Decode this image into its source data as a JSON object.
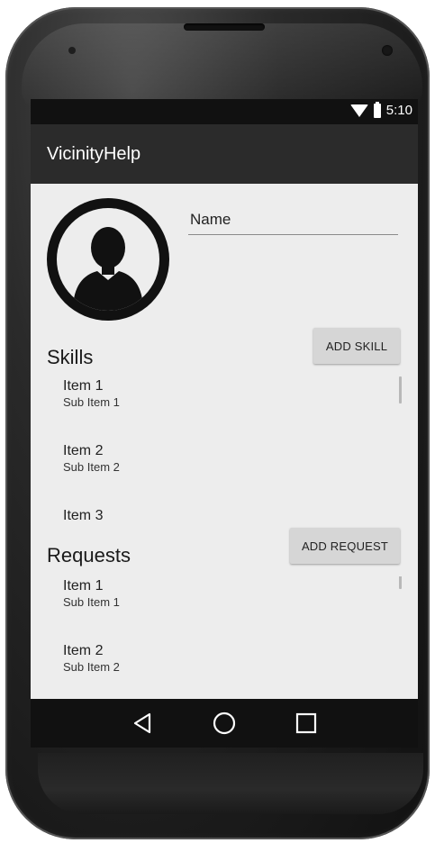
{
  "status_bar": {
    "time": "5:10",
    "icons": [
      "wifi-icon",
      "battery-icon"
    ]
  },
  "app_bar": {
    "title": "VicinityHelp"
  },
  "profile": {
    "name_placeholder": "Name",
    "avatar_icon": "person-icon"
  },
  "skills": {
    "title": "Skills",
    "add_button": "ADD SKILL",
    "items": [
      {
        "title": "Item 1",
        "subtitle": "Sub Item 1"
      },
      {
        "title": "Item 2",
        "subtitle": "Sub Item 2"
      },
      {
        "title": "Item 3",
        "subtitle": ""
      }
    ]
  },
  "requests": {
    "title": "Requests",
    "add_button": "ADD REQUEST",
    "items": [
      {
        "title": "Item 1",
        "subtitle": "Sub Item 1"
      },
      {
        "title": "Item 2",
        "subtitle": "Sub Item 2"
      }
    ]
  },
  "nav_bar": {
    "icons": [
      "back-icon",
      "home-icon",
      "recents-icon"
    ]
  },
  "colors": {
    "app_bar": "#2b2b2b",
    "status_bar": "#111111",
    "screen_bg": "#ededed",
    "button_bg": "#d6d6d6"
  }
}
